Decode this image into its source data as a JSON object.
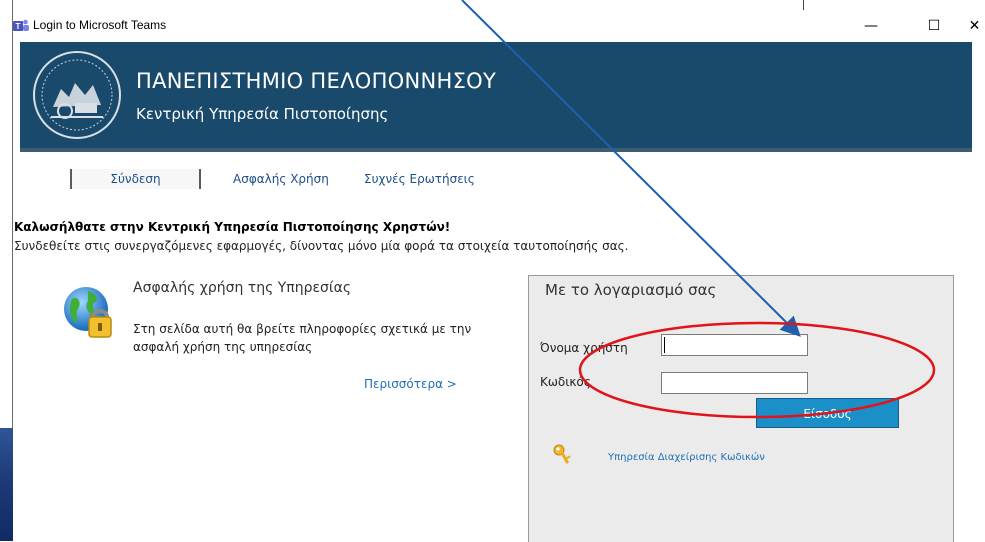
{
  "window": {
    "title": "Login to Microsoft Teams",
    "controls": {
      "minimize": "—",
      "maximize": "☐",
      "close": "✕"
    }
  },
  "banner": {
    "title": "ΠΑΝΕΠΙΣΤΗΜΙΟ ΠΕΛΟΠΟΝΝΗΣΟΥ",
    "subtitle": "Κεντρική Υπηρεσία Πιστοποίησης",
    "color": "#1a4a6b"
  },
  "nav": {
    "active": "Σύνδεση",
    "items": [
      "Ασφαλής Χρήση",
      "Συχνές Ερωτήσεις"
    ]
  },
  "welcome": {
    "title": "Καλωσήλθατε στην Κεντρική Υπηρεσία Πιστοποίησης Χρηστών!",
    "description": "Συνδεθείτε στις συνεργαζόμενες εφαρμογές, δίνοντας μόνο μία φορά τα στοιχεία ταυτοποίησής σας."
  },
  "info": {
    "icon": "globe-lock-icon",
    "title": "Ασφαλής χρήση της Υπηρεσίας",
    "text": "Στη σελίδα αυτή θα βρείτε πληροφορίες σχετικά με την ασφαλή χρήση της υπηρεσίας",
    "more_link": "Περισσότερα >"
  },
  "login": {
    "title": "Με το λογαριασμό σας",
    "username_label": "Όνομα χρήστη",
    "username_value": "",
    "password_label": "Κωδικός",
    "password_value": "",
    "submit_label": "Είσοδος",
    "password_service_link": "Υπηρεσία Διαχείρισης Κωδικών",
    "key_icon": "key-icon",
    "button_color": "#1b8fc8"
  },
  "annotations": {
    "arrow_color": "#1f5fb0",
    "ellipse_color": "#e0141b"
  }
}
